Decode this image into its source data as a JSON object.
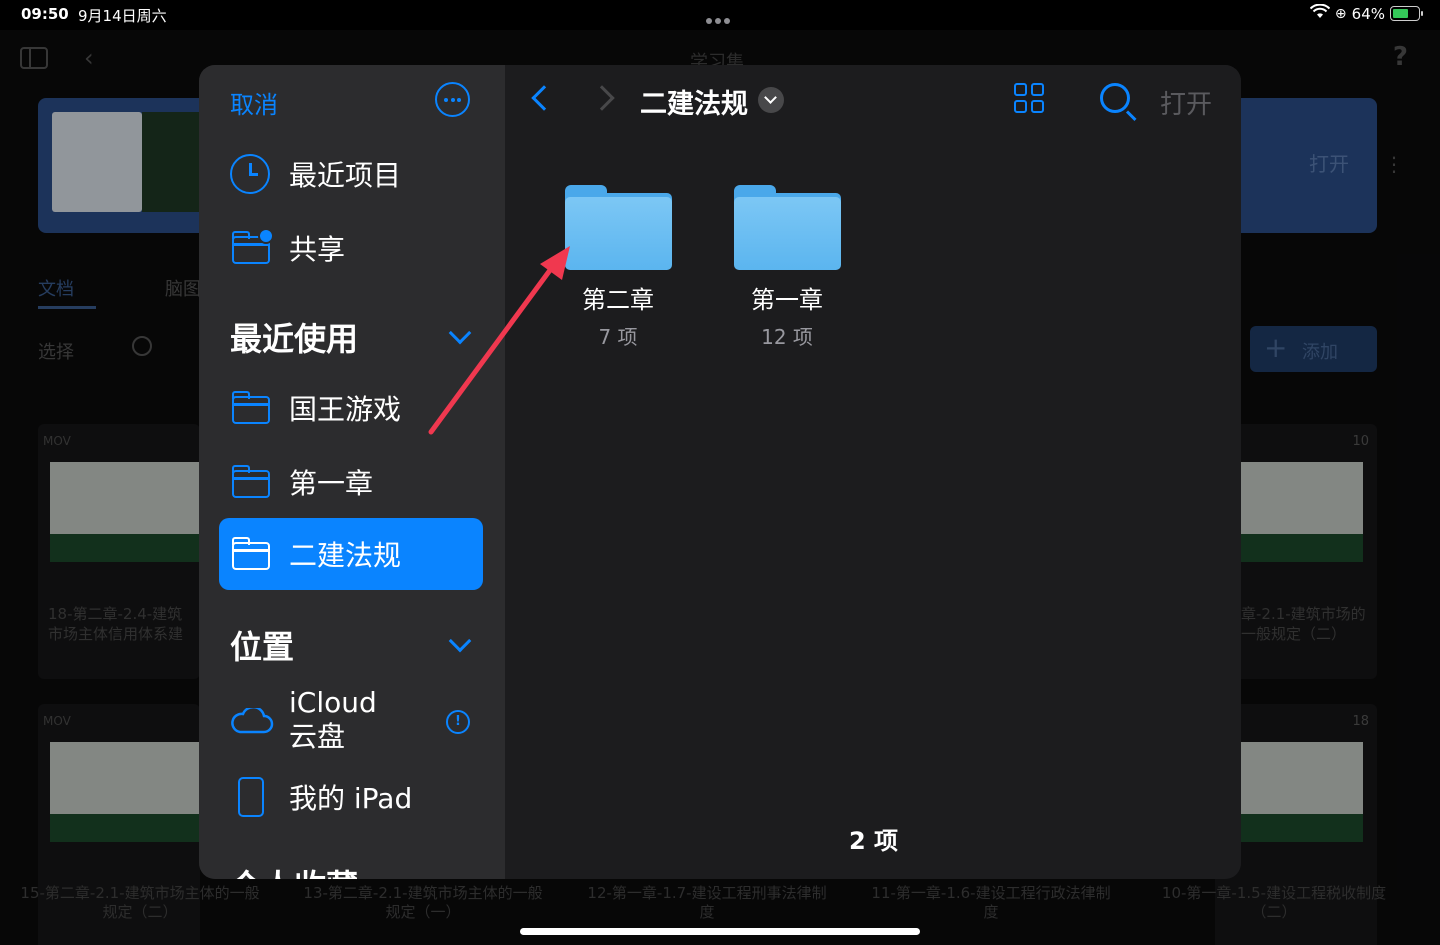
{
  "status_bar": {
    "time": "09:50",
    "date": "9月14日周六",
    "battery": "64%"
  },
  "background_app": {
    "title": "学习集",
    "hero_open": "打开",
    "tabs": [
      "文档",
      "脑图"
    ],
    "select": "选择",
    "add": "添加",
    "cards": [
      {
        "tag": "MOV",
        "num": "",
        "caption": "18-第二章-2.4-建筑市场主体信用体系建"
      },
      {
        "tag": "",
        "num": "10",
        "caption": "章-2.1-建筑市场的一般规定（二）"
      },
      {
        "tag": "MOV",
        "num": "",
        "caption": ""
      },
      {
        "tag": "",
        "num": "18",
        "caption": ""
      }
    ],
    "bottom_captions": [
      "15-第二章-2.1-建筑市场主体的一般规定（二）",
      "13-第二章-2.1-建筑市场主体的一般规定（一）",
      "12-第一章-1.7-建设工程刑事法律制度",
      "11-第一章-1.6-建设工程行政法律制度",
      "10-第一章-1.5-建设工程税收制度（二）"
    ]
  },
  "picker": {
    "cancel": "取消",
    "sidebar": {
      "recents": "最近项目",
      "shared": "共享",
      "recent_section": "最近使用",
      "recent_items": [
        "国王游戏",
        "第一章",
        "二建法规"
      ],
      "locations_section": "位置",
      "icloud": "iCloud\n云盘",
      "icloud_line1": "iCloud",
      "icloud_line2": "云盘",
      "ipad": "我的 iPad",
      "favorites_section": "个人收藏"
    },
    "toolbar": {
      "folder_title": "二建法规",
      "open": "打开"
    },
    "items": [
      {
        "name": "第二章",
        "count": "7 项"
      },
      {
        "name": "第一章",
        "count": "12 项"
      }
    ],
    "footer_count": "2 项"
  },
  "colors": {
    "accent": "#0a84ff",
    "folder": "#5bb5ef",
    "annotation_arrow": "#f0384f"
  }
}
